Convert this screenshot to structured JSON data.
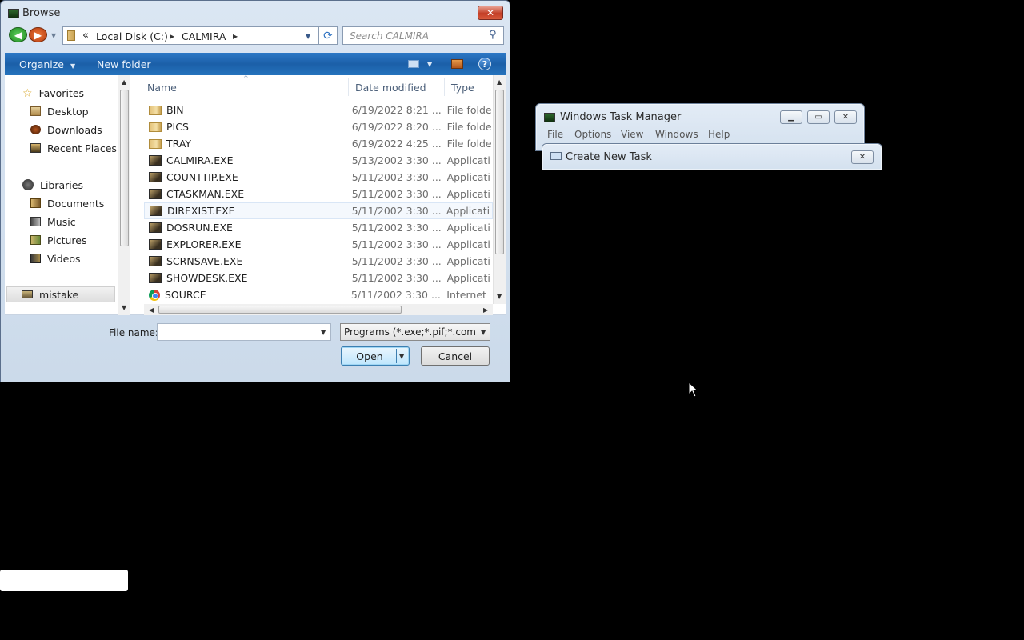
{
  "task_manager": {
    "title": "Windows Task Manager",
    "menu": [
      "File",
      "Options",
      "View",
      "Windows",
      "Help"
    ]
  },
  "create_task": {
    "title": "Create New Task"
  },
  "browse": {
    "title": "Browse",
    "breadcrumb": {
      "overflow": "«",
      "items": [
        "Local Disk (C:)",
        "CALMIRA"
      ]
    },
    "search_placeholder": "Search CALMIRA",
    "toolbar": {
      "organize": "Organize",
      "new_folder": "New folder"
    },
    "nav": {
      "favorites": "Favorites",
      "favorites_items": [
        "Desktop",
        "Downloads",
        "Recent Places"
      ],
      "libraries": "Libraries",
      "libraries_items": [
        "Documents",
        "Music",
        "Pictures",
        "Videos"
      ],
      "network_item": "mistake"
    },
    "columns": {
      "name": "Name",
      "date": "Date modified",
      "type": "Type"
    },
    "files": [
      {
        "name": "BIN",
        "date": "6/19/2022 8:21 ...",
        "type": "File folde",
        "icon": "folder-icon"
      },
      {
        "name": "PICS",
        "date": "6/19/2022 8:20 ...",
        "type": "File folde",
        "icon": "folder-icon"
      },
      {
        "name": "TRAY",
        "date": "6/19/2022 4:25 ...",
        "type": "File folde",
        "icon": "folder-icon"
      },
      {
        "name": "CALMIRA.EXE",
        "date": "5/13/2002 3:30 ...",
        "type": "Applicati",
        "icon": "exe-icon"
      },
      {
        "name": "COUNTTIP.EXE",
        "date": "5/11/2002 3:30 ...",
        "type": "Applicati",
        "icon": "exe-icon"
      },
      {
        "name": "CTASKMAN.EXE",
        "date": "5/11/2002 3:30 ...",
        "type": "Applicati",
        "icon": "exe-icon"
      },
      {
        "name": "DIREXIST.EXE",
        "date": "5/11/2002 3:30 ...",
        "type": "Applicati",
        "icon": "exe-icon"
      },
      {
        "name": "DOSRUN.EXE",
        "date": "5/11/2002 3:30 ...",
        "type": "Applicati",
        "icon": "exe-icon"
      },
      {
        "name": "EXPLORER.EXE",
        "date": "5/11/2002 3:30 ...",
        "type": "Applicati",
        "icon": "exe-icon"
      },
      {
        "name": "SCRNSAVE.EXE",
        "date": "5/11/2002 3:30 ...",
        "type": "Applicati",
        "icon": "exe-icon"
      },
      {
        "name": "SHOWDESK.EXE",
        "date": "5/11/2002 3:30 ...",
        "type": "Applicati",
        "icon": "exe-icon"
      },
      {
        "name": "SOURCE",
        "date": "5/11/2002 3:30 ...",
        "type": "Internet",
        "icon": "chrome-icon"
      }
    ],
    "file_name_label": "File name:",
    "file_name_value": "",
    "filter": "Programs (*.exe;*.pif;*.com;*.ba",
    "open_label": "Open",
    "cancel_label": "Cancel"
  }
}
